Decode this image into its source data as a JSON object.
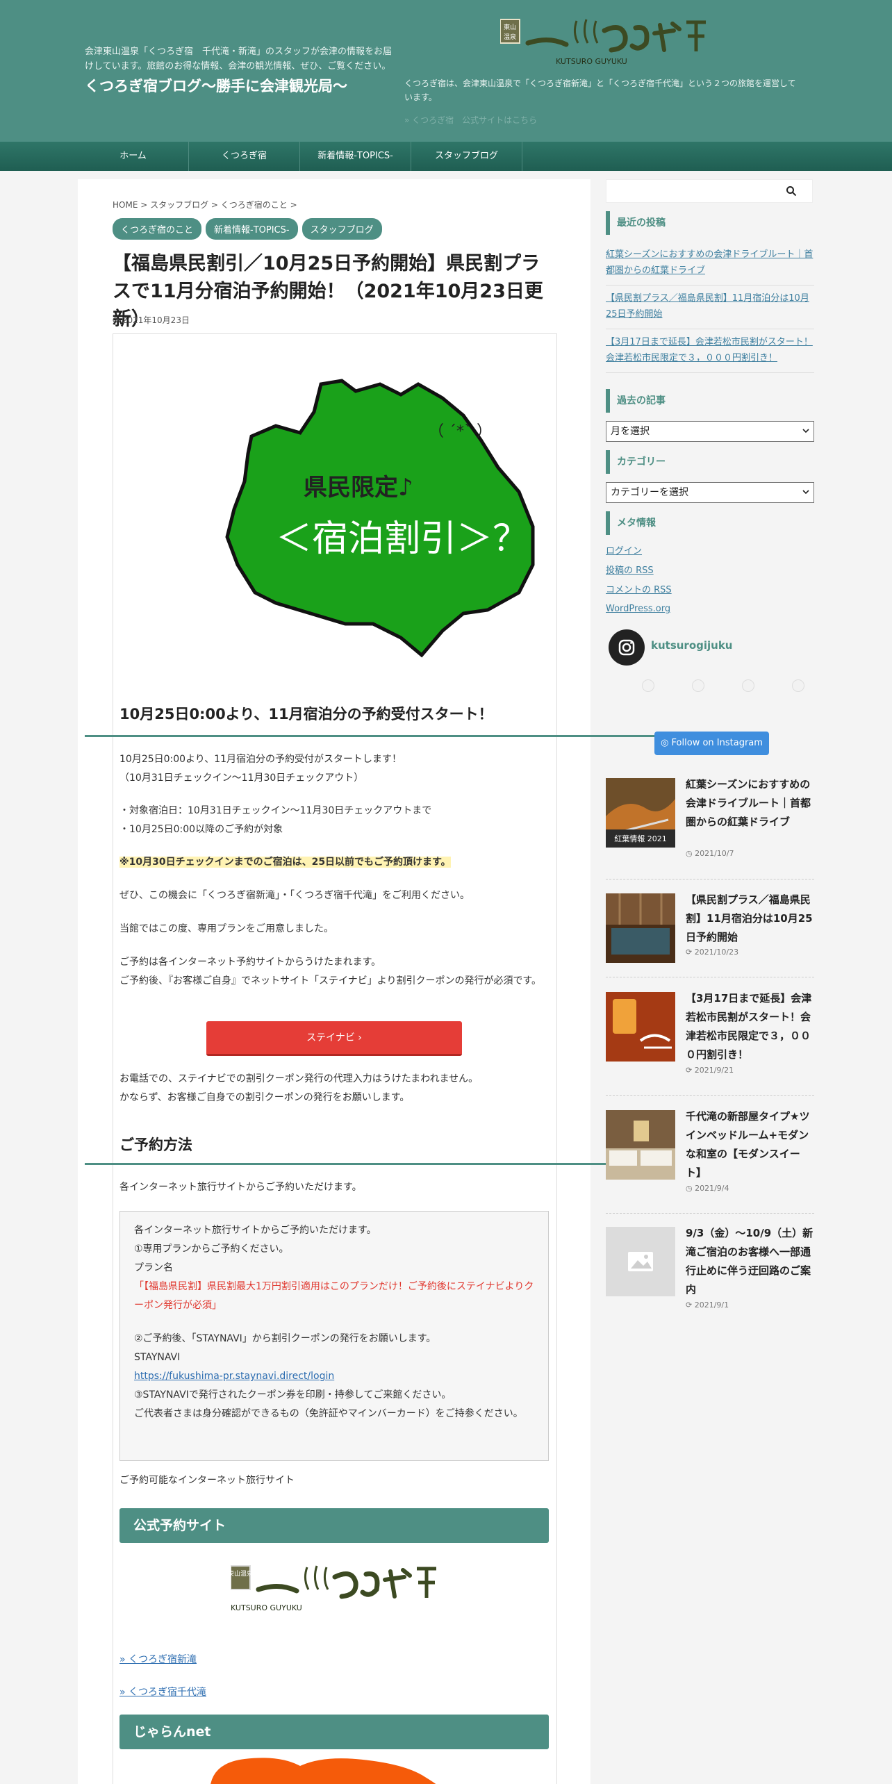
{
  "header": {
    "tagline": "会津東山温泉「くつろぎ宿　千代滝・新滝」のスタッフが会津の情報をお届けしています。旅館のお得な情報、会津の観光情報、ぜひ、ご覧ください。",
    "site_title": "くつろぎ宿ブログ～勝手に会津観光局～",
    "logo_sub": "KUTSURO GUYUKU",
    "logo_badge": "東山温泉",
    "description": "くつろぎ宿は、会津東山温泉で「くつろぎ宿新滝」と「くつろぎ宿千代滝」という２つの旅館を運営しています。",
    "link": "» くつろぎ宿　公式サイトはこちら"
  },
  "nav": {
    "items": [
      "ホーム",
      "くつろぎ宿",
      "新着情報-TOPICS-",
      "スタッフブログ"
    ]
  },
  "article": {
    "breadcrumb": "HOME > スタッフブログ > くつろぎ宿のこと >",
    "categories": [
      "くつろぎ宿のこと",
      "新着情報-TOPICS-",
      "スタッフブログ"
    ],
    "title": "【福島県民割引／10月25日予約開始】県民割プラスで11月分宿泊予約開始！（2021年10月23日更新）",
    "date": "2021年10月23日",
    "illustration": {
      "face": "（ ´*` ）",
      "line1": "県民限定♪",
      "line2": "＜宿泊割引＞？！"
    },
    "h2_1": "10月25日0:00より、11月宿泊分の予約受付スタート！",
    "p1a": "10月25日0:00より、11月宿泊分の予約受付がスタートします！",
    "p1b": "（10月31日チェックイン～11月30日チェックアウト）",
    "p2a": "・対象宿泊日：10月31日チェックイン～11月30日チェックアウトまで",
    "p2b": "・10月25日0:00以降のご予約が対象",
    "p3": "※10月30日チェックインまでのご宿泊は、25日以前でもご予約頂けます。",
    "p4": "ぜひ、この機会に「くつろぎ宿新滝」・「くつろぎ宿千代滝」をご利用ください。",
    "p5": "当館ではこの度、専用プランをご用意しました。",
    "p6a": "ご予約は各インターネット予約サイトからうけたまれます。",
    "p6b": "ご予約後、『お客様ご自身』でネットサイト「ステイナビ」より割引クーポンの発行が必須です。",
    "staynavi_button": "ステイナビ ›",
    "p7a": "お電話での、ステイナビでの割引クーポン発行の代理入力はうけたまわれません。",
    "p7b": "かならず、お客様ご自身での割引クーポンの発行をお願いします。",
    "h2_2": "ご予約方法",
    "p8": "各インターネット旅行サイトからご予約いただけます。",
    "box": {
      "l1": "各インターネット旅行サイトからご予約いただけます。",
      "l2": "①専用プランからご予約ください。",
      "l3": "プラン名",
      "l4": "「【福島県民割】県民割最大1万円割引適用はこのプランだけ！ご予約後にステイナビよりクーポン発行が必須」",
      "l5": "②ご予約後、「STAYNAVI」から割引クーポンの発行をお願いします。",
      "l6": "STAYNAVI",
      "l7": "https://fukushima-pr.staynavi.direct/login",
      "l8": "③STAYNAVIで発行されたクーポン券を印刷・持参してご来館ください。",
      "l9": "ご代表者さまは身分確認ができるもの（免許証やマインバーカード）をご持参ください。"
    },
    "p9": "ご予約可能なインターネット旅行サイト",
    "sec1": "公式予約サイト",
    "link1": "» くつろぎ宿新滝",
    "link2": "» くつろぎ宿千代滝",
    "sec2": "じゃらんnet"
  },
  "sidebar": {
    "recent_title": "最近の投稿",
    "recent": [
      "紅葉シーズンにおすすめの会津ドライブルート｜首都圏からの紅葉ドライブ",
      "【県民割プラス／福島県民割】11月宿泊分は10月25日予約開始",
      "【3月17日まで延長】会津若松市民割がスタート！会津若松市民限定で３，０００円割引き！"
    ],
    "archive_title": "過去の記事",
    "archive_select": "月を選択",
    "category_title": "カテゴリー",
    "category_select": "カテゴリーを選択",
    "meta_title": "メタ情報",
    "meta_links": [
      "ログイン",
      "投稿の RSS",
      "コメントの RSS",
      "WordPress.org"
    ],
    "instagram_name": "kutsurogijuku",
    "instagram_follow": "Follow on Instagram",
    "posts": [
      {
        "title": "紅葉シーズンにおすすめの会津ドライブルート｜首都圏からの紅葉ドライブ",
        "date": "2021/10/7",
        "thumb_caption": "紅葉情報 2021",
        "color": "#7a5a2e"
      },
      {
        "title": "【県民割プラス／福島県民割】11月宿泊分は10月25日予約開始",
        "date": "2021/10/23",
        "color": "#5b3b20"
      },
      {
        "title": "【3月17日まで延長】会津若松市民割がスタート！会津若松市民限定で３，０００円割引き！",
        "date": "2021/9/21",
        "color": "#b8461c"
      },
      {
        "title": "千代滝の新部屋タイプ★ツインベッドルーム+モダンな和室の【モダンスイート】",
        "date": "2021/9/4",
        "color": "#8a6f52"
      },
      {
        "title": "9/3（金）～10/9（土）新滝ご宿泊のお客様へ一部通行止めに伴う迂回路のご案内",
        "date": "2021/9/1",
        "color": "#dddddd"
      }
    ]
  }
}
